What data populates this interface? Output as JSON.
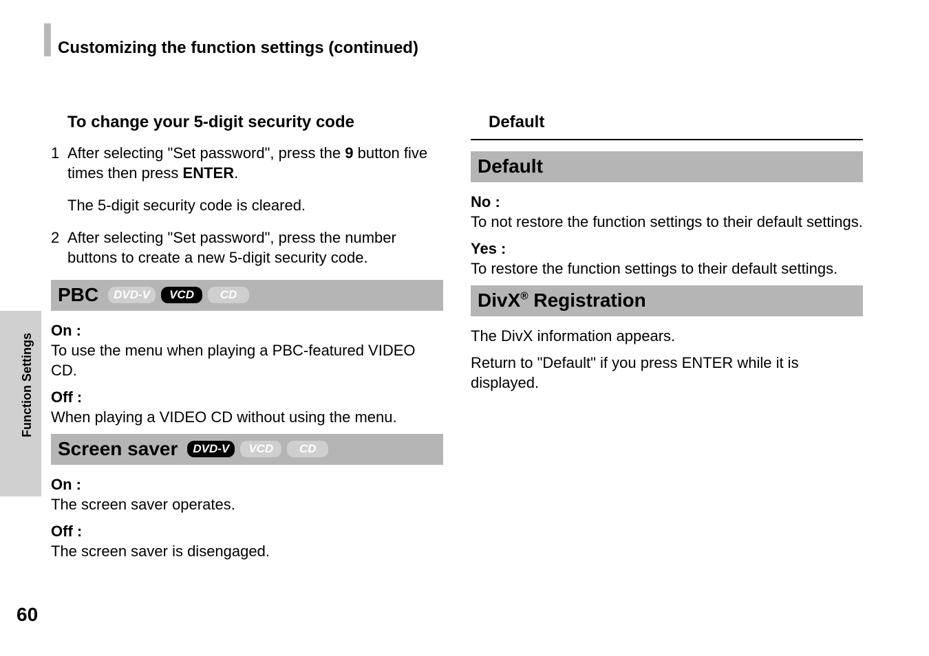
{
  "page_number": "60",
  "side_label": "Function Settings",
  "continued_title": "Customizing the function settings (continued)",
  "left": {
    "change_code_heading": "To change your 5-digit security code",
    "step1_num": "1",
    "step1_a": "After selecting \"Set password\", press the ",
    "step1_bold1": "9",
    "step1_b": " button five times then press ",
    "step1_bold2": "ENTER",
    "step1_c": ".",
    "step1_result": "The 5-digit security code is cleared.",
    "step2_num": "2",
    "step2_text": "After selecting \"Set password\", press the number buttons to create a new 5-digit security code.",
    "pbc": {
      "title": "PBC",
      "badges": {
        "dvdv": "DVD-V",
        "vcd": "VCD",
        "cd": "CD"
      },
      "on_label": "On :",
      "on_desc": "To use the menu when playing a PBC-featured VIDEO CD.",
      "off_label": "Off :",
      "off_desc": "When playing a VIDEO CD without using the menu."
    },
    "screensaver": {
      "title": "Screen saver",
      "badges": {
        "dvdv": "DVD-V",
        "vcd": "VCD",
        "cd": "CD"
      },
      "on_label": "On :",
      "on_desc": "The screen saver operates.",
      "off_label": "Off :",
      "off_desc": "The screen saver is disengaged."
    }
  },
  "right": {
    "summary_heading": "Default",
    "default_section": {
      "title": "Default",
      "no_label": "No :",
      "no_desc": "To not restore the function settings to their default settings.",
      "yes_label": "Yes :",
      "yes_desc": "To restore the function settings to their default settings."
    },
    "divx_section": {
      "title_a": "DivX",
      "title_sup": "®",
      "title_b": " Registration",
      "line1": "The DivX information appears.",
      "line2": "Return to \"Default\" if you press ENTER while it is displayed."
    }
  }
}
